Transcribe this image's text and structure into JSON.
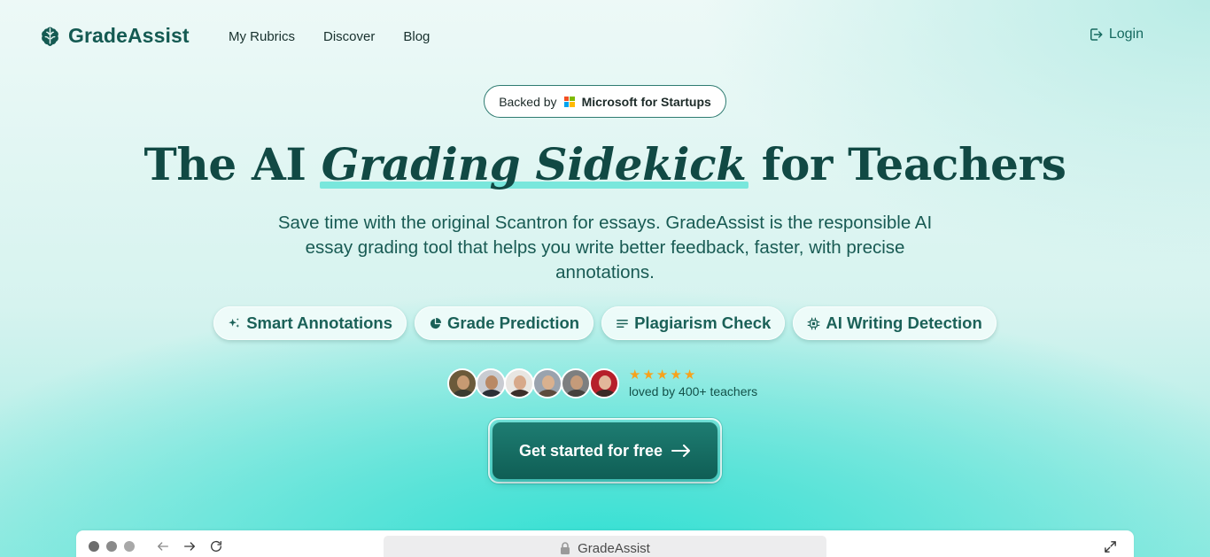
{
  "nav": {
    "brand": "GradeAssist",
    "links": [
      "My Rubrics",
      "Discover",
      "Blog"
    ],
    "login": "Login"
  },
  "badge": {
    "prefix": "Backed by",
    "brand": "Microsoft for Startups"
  },
  "hero": {
    "title_pre": "The AI",
    "title_em": "Grading Sidekick",
    "title_post": "for Teachers",
    "subtitle": "Save time with the original Scantron for essays. GradeAssist is the responsible AI essay grading tool that helps you write better feedback, faster, with precise annotations."
  },
  "features": [
    {
      "label": "Smart Annotations",
      "icon": "sparkles-icon"
    },
    {
      "label": "Grade Prediction",
      "icon": "pie-chart-icon"
    },
    {
      "label": "Plagiarism Check",
      "icon": "lines-icon"
    },
    {
      "label": "AI Writing Detection",
      "icon": "cpu-chip-icon"
    }
  ],
  "social_proof": {
    "rating": 5,
    "label": "loved by 400+ teachers",
    "avatar_count": 6
  },
  "cta": {
    "label": "Get started for free",
    "icon": "arrow-right-icon"
  },
  "browser": {
    "address": "GradeAssist"
  },
  "colors": {
    "brand": "#145a52",
    "cta": "#0f5e55",
    "star": "#f7a21b",
    "highlight": "#79e7dc"
  }
}
